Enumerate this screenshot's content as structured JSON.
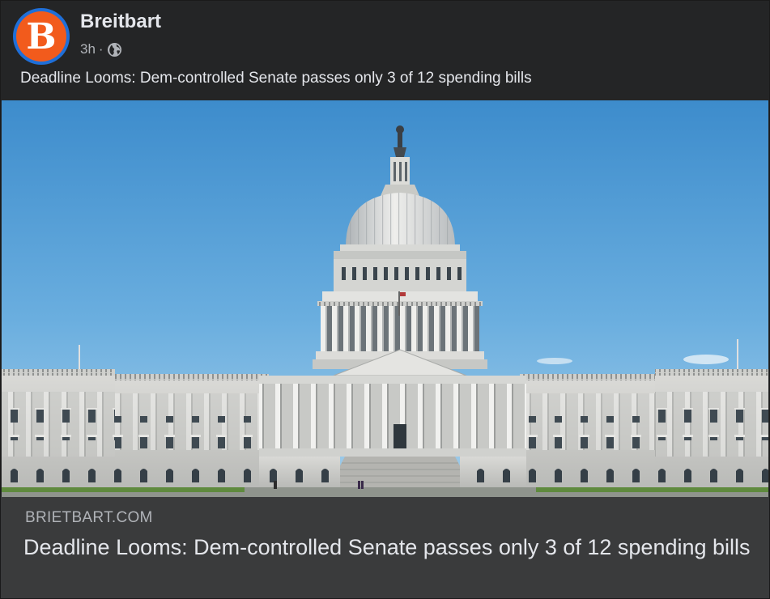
{
  "post": {
    "page_name": "Breitbart",
    "avatar_letter": "B",
    "time": "3h",
    "separator": "·",
    "audience_icon": "globe-icon",
    "caption": "Deadline Looms: Dem-controlled Senate passes only 3 of 12 spending bills"
  },
  "link_preview": {
    "domain": "BRIETBART.COM",
    "title": "Deadline Looms: Dem-controlled Senate passes only 3 of 12 spending bills"
  },
  "colors": {
    "background": "#242526",
    "footer_background": "#3a3b3c",
    "avatar_ring": "#1f6fd8",
    "avatar_fill": "#f25b1c",
    "text_primary": "#e4e6eb",
    "text_secondary": "#b0b3b8"
  }
}
